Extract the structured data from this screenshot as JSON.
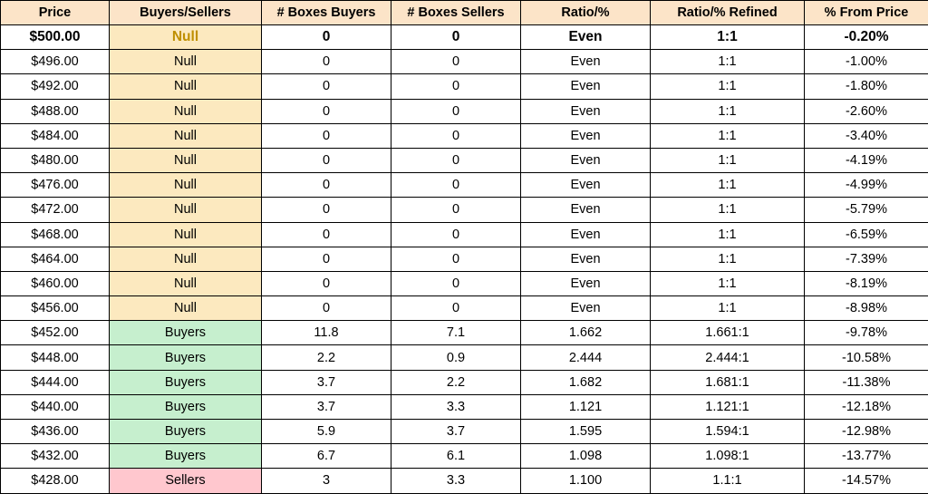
{
  "table": {
    "columns": [
      "Price",
      "Buyers/Sellers",
      "# Boxes Buyers",
      "# Boxes Sellers",
      "Ratio/%",
      "Ratio/% Refined",
      "% From Price"
    ],
    "rows": [
      {
        "price": "$500.00",
        "category": "Null",
        "boxes_buyers": "0",
        "boxes_sellers": "0",
        "ratio": "Even",
        "ratio_refined": "1:1",
        "pct_from_price": "-0.20%"
      },
      {
        "price": "$496.00",
        "category": "Null",
        "boxes_buyers": "0",
        "boxes_sellers": "0",
        "ratio": "Even",
        "ratio_refined": "1:1",
        "pct_from_price": "-1.00%"
      },
      {
        "price": "$492.00",
        "category": "Null",
        "boxes_buyers": "0",
        "boxes_sellers": "0",
        "ratio": "Even",
        "ratio_refined": "1:1",
        "pct_from_price": "-1.80%"
      },
      {
        "price": "$488.00",
        "category": "Null",
        "boxes_buyers": "0",
        "boxes_sellers": "0",
        "ratio": "Even",
        "ratio_refined": "1:1",
        "pct_from_price": "-2.60%"
      },
      {
        "price": "$484.00",
        "category": "Null",
        "boxes_buyers": "0",
        "boxes_sellers": "0",
        "ratio": "Even",
        "ratio_refined": "1:1",
        "pct_from_price": "-3.40%"
      },
      {
        "price": "$480.00",
        "category": "Null",
        "boxes_buyers": "0",
        "boxes_sellers": "0",
        "ratio": "Even",
        "ratio_refined": "1:1",
        "pct_from_price": "-4.19%"
      },
      {
        "price": "$476.00",
        "category": "Null",
        "boxes_buyers": "0",
        "boxes_sellers": "0",
        "ratio": "Even",
        "ratio_refined": "1:1",
        "pct_from_price": "-4.99%"
      },
      {
        "price": "$472.00",
        "category": "Null",
        "boxes_buyers": "0",
        "boxes_sellers": "0",
        "ratio": "Even",
        "ratio_refined": "1:1",
        "pct_from_price": "-5.79%"
      },
      {
        "price": "$468.00",
        "category": "Null",
        "boxes_buyers": "0",
        "boxes_sellers": "0",
        "ratio": "Even",
        "ratio_refined": "1:1",
        "pct_from_price": "-6.59%"
      },
      {
        "price": "$464.00",
        "category": "Null",
        "boxes_buyers": "0",
        "boxes_sellers": "0",
        "ratio": "Even",
        "ratio_refined": "1:1",
        "pct_from_price": "-7.39%"
      },
      {
        "price": "$460.00",
        "category": "Null",
        "boxes_buyers": "0",
        "boxes_sellers": "0",
        "ratio": "Even",
        "ratio_refined": "1:1",
        "pct_from_price": "-8.19%"
      },
      {
        "price": "$456.00",
        "category": "Null",
        "boxes_buyers": "0",
        "boxes_sellers": "0",
        "ratio": "Even",
        "ratio_refined": "1:1",
        "pct_from_price": "-8.98%"
      },
      {
        "price": "$452.00",
        "category": "Buyers",
        "boxes_buyers": "11.8",
        "boxes_sellers": "7.1",
        "ratio": "1.662",
        "ratio_refined": "1.661:1",
        "pct_from_price": "-9.78%"
      },
      {
        "price": "$448.00",
        "category": "Buyers",
        "boxes_buyers": "2.2",
        "boxes_sellers": "0.9",
        "ratio": "2.444",
        "ratio_refined": "2.444:1",
        "pct_from_price": "-10.58%"
      },
      {
        "price": "$444.00",
        "category": "Buyers",
        "boxes_buyers": "3.7",
        "boxes_sellers": "2.2",
        "ratio": "1.682",
        "ratio_refined": "1.681:1",
        "pct_from_price": "-11.38%"
      },
      {
        "price": "$440.00",
        "category": "Buyers",
        "boxes_buyers": "3.7",
        "boxes_sellers": "3.3",
        "ratio": "1.121",
        "ratio_refined": "1.121:1",
        "pct_from_price": "-12.18%"
      },
      {
        "price": "$436.00",
        "category": "Buyers",
        "boxes_buyers": "5.9",
        "boxes_sellers": "3.7",
        "ratio": "1.595",
        "ratio_refined": "1.594:1",
        "pct_from_price": "-12.98%"
      },
      {
        "price": "$432.00",
        "category": "Buyers",
        "boxes_buyers": "6.7",
        "boxes_sellers": "6.1",
        "ratio": "1.098",
        "ratio_refined": "1.098:1",
        "pct_from_price": "-13.77%"
      },
      {
        "price": "$428.00",
        "category": "Sellers",
        "boxes_buyers": "3",
        "boxes_sellers": "3.3",
        "ratio": "1.100",
        "ratio_refined": "1.1:1",
        "pct_from_price": "-14.57%"
      }
    ]
  }
}
